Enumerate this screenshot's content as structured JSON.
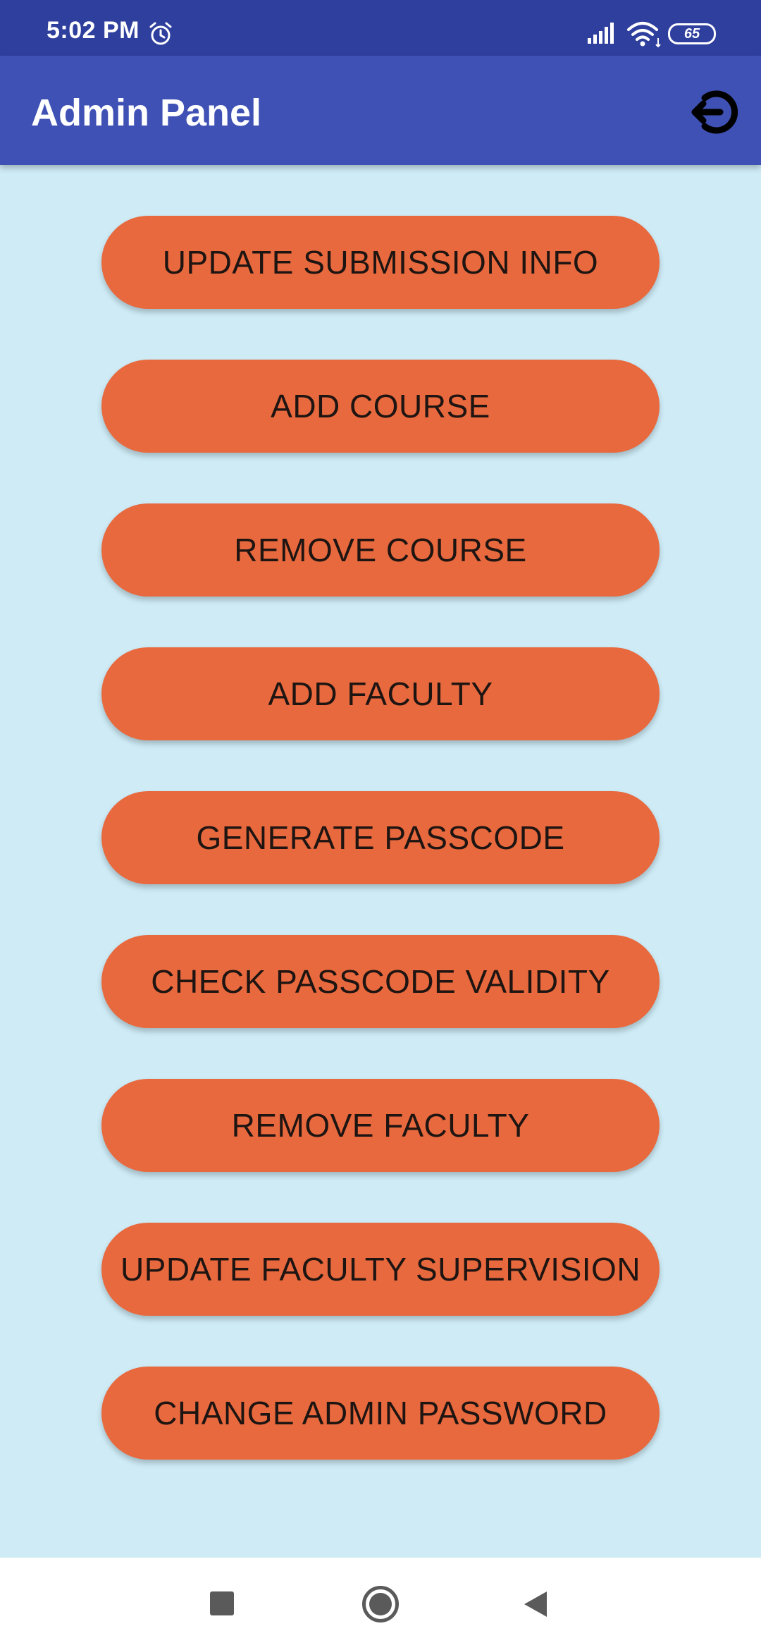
{
  "status_bar": {
    "time": "5:02 PM",
    "battery": "65",
    "icons": [
      "alarm-icon",
      "signal-icon",
      "wifi-icon",
      "battery-icon"
    ]
  },
  "app_bar": {
    "title": "Admin Panel",
    "logout_icon": "logout-icon"
  },
  "buttons": [
    {
      "label": "UPDATE SUBMISSION INFO"
    },
    {
      "label": "ADD COURSE"
    },
    {
      "label": "REMOVE COURSE"
    },
    {
      "label": "ADD FACULTY"
    },
    {
      "label": "GENERATE PASSCODE"
    },
    {
      "label": "CHECK PASSCODE VALIDITY"
    },
    {
      "label": "REMOVE FACULTY"
    },
    {
      "label": "UPDATE FACULTY SUPERVISION"
    },
    {
      "label": "CHANGE ADMIN PASSWORD"
    }
  ],
  "nav_bar": {
    "icons": [
      "recents-icon",
      "home-icon",
      "back-icon"
    ]
  },
  "colors": {
    "status_bar": "#2f3f9e",
    "app_bar": "#3f51b5",
    "background": "#ceebf6",
    "button": "#e8693e",
    "button_text": "#1e1512"
  }
}
